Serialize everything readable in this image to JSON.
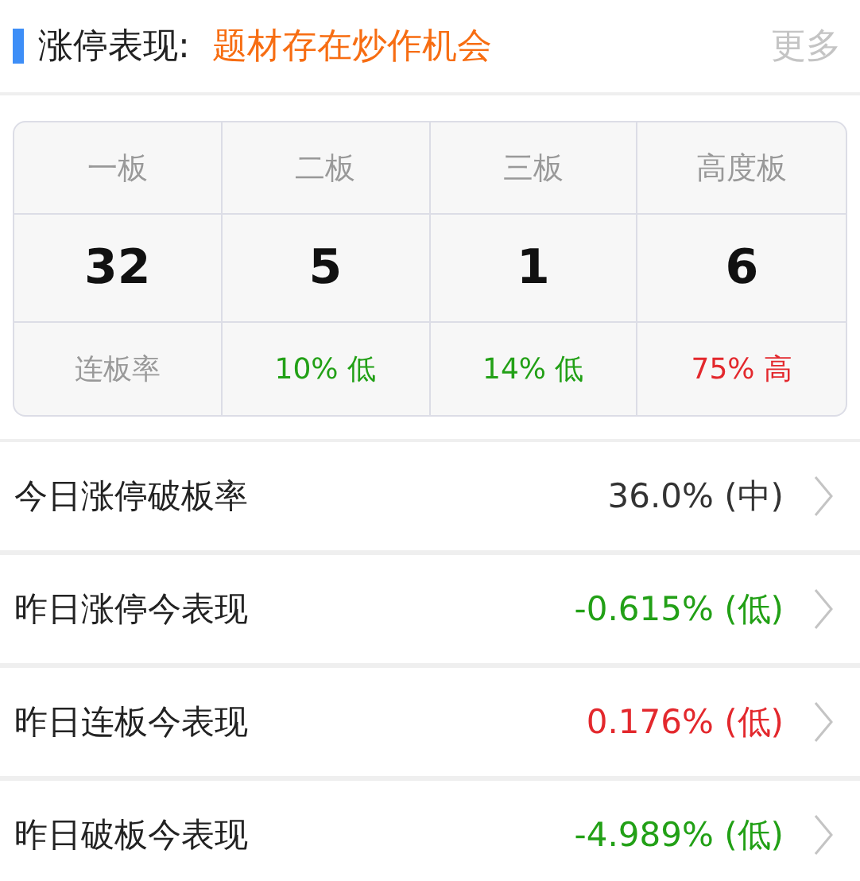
{
  "header": {
    "title": "涨停表现:",
    "subtitle": "题材存在炒作机会",
    "more": "更多"
  },
  "board_table": {
    "columns": [
      {
        "label": "一板",
        "count": "32",
        "rate": "连板率",
        "color": "#999999"
      },
      {
        "label": "二板",
        "count": "5",
        "rate": "10% 低",
        "color": "#22a016"
      },
      {
        "label": "三板",
        "count": "1",
        "rate": "14% 低",
        "color": "#22a016"
      },
      {
        "label": "高度板",
        "count": "6",
        "rate": "75% 高",
        "color": "#e3282d"
      }
    ]
  },
  "rows": [
    {
      "label": "今日涨停破板率",
      "value": "36.0% (中)",
      "color": "#333333"
    },
    {
      "label": "昨日涨停今表现",
      "value": "-0.615% (低)",
      "color": "#22a016"
    },
    {
      "label": "昨日连板今表现",
      "value": "0.176% (低)",
      "color": "#e3282d"
    },
    {
      "label": "昨日破板今表现",
      "value": "-4.989% (低)",
      "color": "#22a016"
    }
  ]
}
